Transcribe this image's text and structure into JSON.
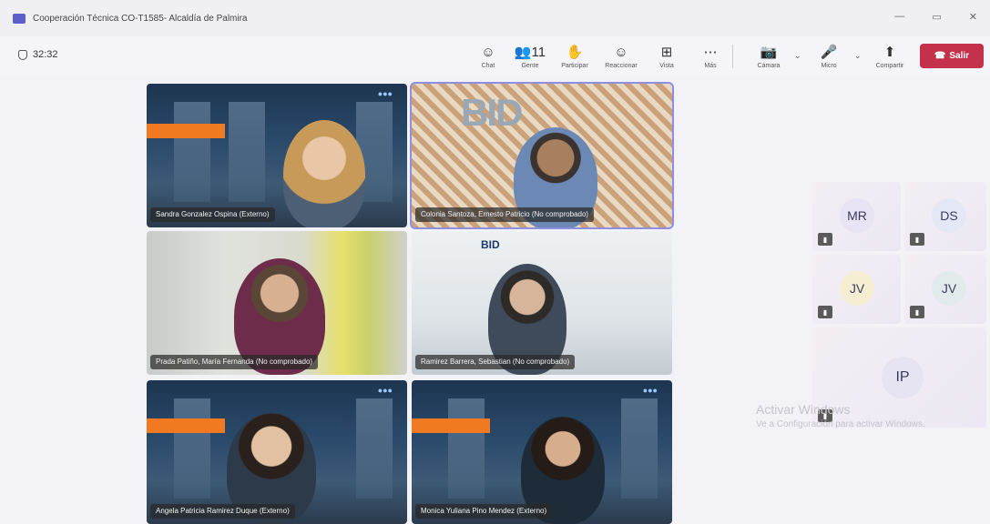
{
  "window": {
    "title": "Cooperación Técnica CO-T1585- Alcaldía de Palmira",
    "controls": [
      "—",
      "▭",
      "✕"
    ]
  },
  "toolbar": {
    "timer": "32:32",
    "buttons": [
      {
        "icon": "chat-icon",
        "glyph": "☺",
        "label": "Chat"
      },
      {
        "icon": "people-icon",
        "glyph": "👥11",
        "label": "Gente"
      },
      {
        "icon": "hand-icon",
        "glyph": "✋",
        "label": "Participar"
      },
      {
        "icon": "react-icon",
        "glyph": "☺",
        "label": "Reaccionar"
      },
      {
        "icon": "view-icon",
        "glyph": "⊞",
        "label": "Vista"
      },
      {
        "icon": "more-icon",
        "glyph": "⋯",
        "label": "Más"
      },
      {
        "icon": "camera-icon",
        "glyph": "📷",
        "label": "Cámara"
      },
      {
        "icon": "mic-icon",
        "glyph": "🎤",
        "label": "Micro"
      },
      {
        "icon": "share-icon",
        "glyph": "⬆",
        "label": "Compartir"
      }
    ],
    "leave_label": "Salir"
  },
  "participants": [
    {
      "name": "Sandra Gonzalez Ospina (Externo)"
    },
    {
      "name": "Colonia Santoza, Ernesto Patricio (No comprobado)"
    },
    {
      "name": "Prada Patiño, María Fernanda (No comprobado)"
    },
    {
      "name": "Ramirez Barrera, Sebastian (No comprobado)"
    },
    {
      "name": "Angela Patricia Ramirez Duque (Externo)"
    },
    {
      "name": "Monica Yuliana Pino Mendez (Externo)"
    }
  ],
  "side_avatars": [
    "MR",
    "DS",
    "JV",
    "JV",
    "IP"
  ],
  "bid_logo": "BID",
  "watermark": {
    "line1": "Activar Windows",
    "line2": "Ve a Configuración para activar Windows."
  },
  "colors": {
    "accent": "#5b5fc7",
    "leave": "#c4314b",
    "banner": "#f07a22"
  }
}
